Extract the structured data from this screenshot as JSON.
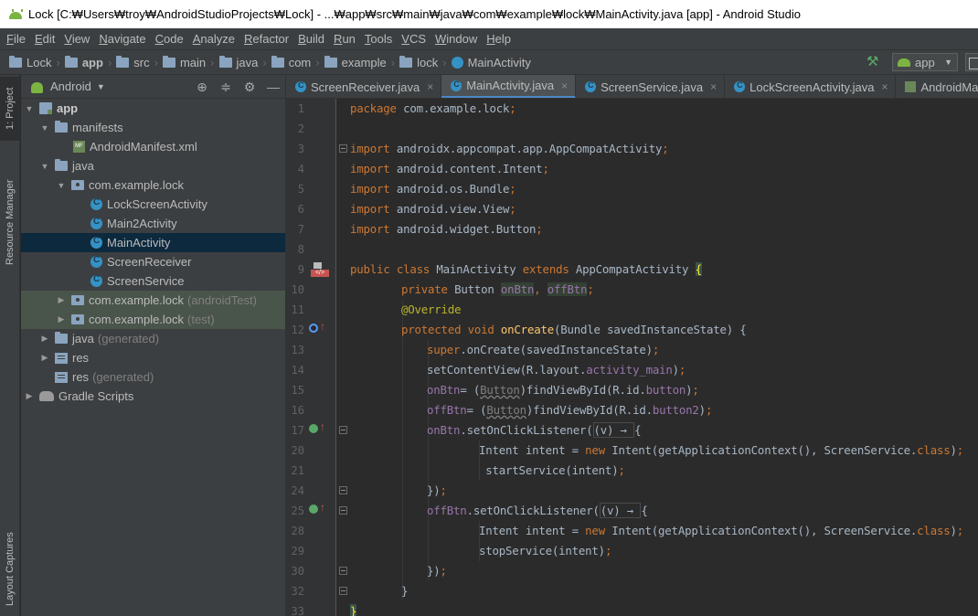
{
  "window": {
    "title": "Lock [C:₩Users₩troy₩AndroidStudioProjects₩Lock] - ...₩app₩src₩main₩java₩com₩example₩lock₩MainActivity.java [app] - Android Studio"
  },
  "menu": [
    "File",
    "Edit",
    "View",
    "Navigate",
    "Code",
    "Analyze",
    "Refactor",
    "Build",
    "Run",
    "Tools",
    "VCS",
    "Window",
    "Help"
  ],
  "breadcrumbs": [
    "Lock",
    "app",
    "src",
    "main",
    "java",
    "com",
    "example",
    "lock",
    "MainActivity"
  ],
  "run_config": {
    "label": "app"
  },
  "tool_windows": {
    "project": "1: Project",
    "resource_manager": "Resource Manager",
    "layout_captures": "Layout Captures"
  },
  "project_panel": {
    "view_mode": "Android",
    "tree": [
      {
        "label": "app",
        "muted": ""
      },
      {
        "label": "manifests",
        "muted": ""
      },
      {
        "label": "AndroidManifest.xml",
        "muted": ""
      },
      {
        "label": "java",
        "muted": ""
      },
      {
        "label": "com.example.lock",
        "muted": ""
      },
      {
        "label": "LockScreenActivity",
        "muted": ""
      },
      {
        "label": "Main2Activity",
        "muted": ""
      },
      {
        "label": "MainActivity",
        "muted": ""
      },
      {
        "label": "ScreenReceiver",
        "muted": ""
      },
      {
        "label": "ScreenService",
        "muted": ""
      },
      {
        "label": "com.example.lock",
        "muted": "(androidTest)"
      },
      {
        "label": "com.example.lock",
        "muted": "(test)"
      },
      {
        "label": "java",
        "muted": "(generated)"
      },
      {
        "label": "res",
        "muted": ""
      },
      {
        "label": "res",
        "muted": "(generated)"
      },
      {
        "label": "Gradle Scripts",
        "muted": ""
      }
    ]
  },
  "tabs": [
    "ScreenReceiver.java",
    "MainActivity.java",
    "ScreenService.java",
    "LockScreenActivity.java",
    "AndroidManifest.xml"
  ],
  "active_tab": "MainActivity.java",
  "editor": {
    "line_numbers": [
      "1",
      "2",
      "3",
      "4",
      "5",
      "6",
      "7",
      "8",
      "9",
      "10",
      "11",
      "12",
      "13",
      "14",
      "15",
      "16",
      "17",
      "20",
      "21",
      "24",
      "25",
      "28",
      "29",
      "30",
      "32",
      "33"
    ],
    "code": {
      "l1_kw": "package ",
      "l1_rest": "com.example.lock",
      "l3_kw": "import ",
      "l3_rest": "androidx.appcompat.app.AppCompatActivity",
      "l4_kw": "import ",
      "l4_rest": "android.content.Intent",
      "l5_kw": "import ",
      "l5_rest": "android.os.Bundle",
      "l6_kw": "import ",
      "l6_rest": "android.view.View",
      "l7_kw": "import ",
      "l7_rest": "android.widget.Button",
      "l9_kw1": "public class ",
      "l9_name": "MainActivity ",
      "l9_kw2": "extends ",
      "l9_sup": "AppCompatActivity ",
      "l9_brace": "{",
      "l10_kw": "private ",
      "l10_type": "Button ",
      "l10_f1": "onBtn",
      "l10_f2": "offBtn",
      "l11_an": "@Override",
      "l12_kw": "protected void ",
      "l12_fn": "onCreate",
      "l12_rest": "(Bundle savedInstanceState) {",
      "l13_kw": "super",
      "l13_rest": ".onCreate(savedInstanceState)",
      "l14_a": "setContentView(R.layout.",
      "l14_fd": "activity_main",
      "l14_b": ")",
      "l15_fd": "onBtn",
      "l15_a": "= (",
      "l15_cast": "Button",
      "l15_b": ")findViewById(R.id.",
      "l15_id": "button",
      "l15_c": ")",
      "l16_fd": "offBtn",
      "l16_a": "= (",
      "l16_cast": "Button",
      "l16_b": ")findViewById(R.id.",
      "l16_id": "button2",
      "l16_c": ")",
      "l17_fd": "onBtn",
      "l17_a": ".setOnClickListener(",
      "l17_v": "(v) → ",
      "l17_b": "{",
      "l20_a": "Intent intent = ",
      "l20_kw": "new ",
      "l20_b": "Intent(getApplicationContext(), ScreenService.",
      "l20_kw2": "class",
      "l20_c": ")",
      "l21_a": " startService(intent)",
      "l24_a": "})",
      "l25_fd": "offBtn",
      "l25_a": ".setOnClickListener(",
      "l25_v": "(v) → ",
      "l25_b": "{",
      "l28_a": "Intent intent = ",
      "l28_kw": "new ",
      "l28_b": "Intent(getApplicationContext(), ScreenService.",
      "l28_kw2": "class",
      "l28_c": ")",
      "l29_a": "stopService(intent)",
      "l30_a": "})",
      "l32_a": "}",
      "l33_a": "}"
    }
  }
}
